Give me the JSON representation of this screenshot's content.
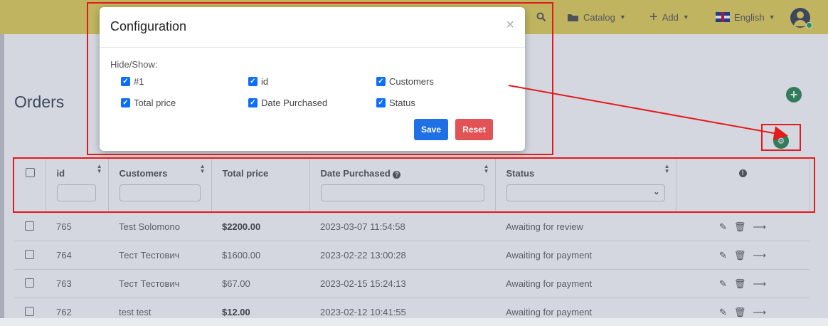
{
  "topbar": {
    "search_icon": "search-icon",
    "catalog_label": "Catalog",
    "add_label": "Add",
    "language_label": "English",
    "user_icon": "user-avatar-icon"
  },
  "page": {
    "title": "Orders"
  },
  "table": {
    "columns": [
      "id",
      "Customers",
      "Total price",
      "Date Purchased",
      "Status"
    ],
    "rows": [
      {
        "id": "765",
        "customer": "Test Solomono",
        "total": "$2200.00",
        "total_bold": true,
        "date": "2023-03-07 11:54:58",
        "status": "Awaiting for review"
      },
      {
        "id": "764",
        "customer": "Тест Тестович",
        "total": "$1600.00",
        "total_bold": false,
        "date": "2023-02-22 13:00:28",
        "status": "Awaiting for payment"
      },
      {
        "id": "763",
        "customer": "Тест Тестович",
        "total": "$67.00",
        "total_bold": false,
        "date": "2023-02-15 15:24:13",
        "status": "Awaiting for payment"
      },
      {
        "id": "762",
        "customer": "test test",
        "total": "$12.00",
        "total_bold": true,
        "date": "2023-02-12 10:41:55",
        "status": "Awaiting for payment"
      }
    ]
  },
  "modal": {
    "title": "Configuration",
    "close_glyph": "×",
    "hide_show_label": "Hide/Show:",
    "options": [
      "#1",
      "id",
      "Customers",
      "Total price",
      "Date Purchased",
      "Status"
    ],
    "save_label": "Save",
    "reset_label": "Reset"
  },
  "colors": {
    "topbar": "#e6d35d",
    "accent_green": "#2e8b57",
    "save_blue": "#1f6fe5",
    "reset_red": "#e35355",
    "annotation_red": "#e41b1b"
  }
}
